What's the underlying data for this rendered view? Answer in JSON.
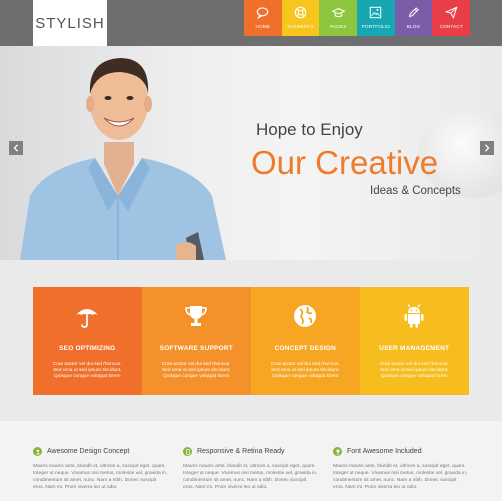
{
  "header": {
    "logo": "STYLISH",
    "nav": [
      {
        "label": "HOME",
        "color": "#f06f2b",
        "icon": "speech-bubble-icon"
      },
      {
        "label": "ELEMENTS",
        "color": "#f7c51e",
        "icon": "lifebuoy-icon"
      },
      {
        "label": "PAGES",
        "color": "#8ec63f",
        "icon": "graduation-cap-icon"
      },
      {
        "label": "PORTFOLIO",
        "color": "#16a7b3",
        "icon": "picture-icon"
      },
      {
        "label": "BLOG",
        "color": "#7a5ca9",
        "icon": "pencil-icon"
      },
      {
        "label": "CONTACT",
        "color": "#e93e47",
        "icon": "paper-plane-icon"
      }
    ]
  },
  "hero": {
    "line1": "Hope to Enjoy",
    "line2": "Our Creative",
    "line3": "Ideas & Concepts"
  },
  "features": [
    {
      "title": "SEO OPTIMIZING",
      "icon": "umbrella-icon",
      "color": "#f06f2b",
      "text": [
        "Cras auctor vel dui sed rhoncus.",
        "Sed urna ut sed ipsum tincidunt.",
        "Quisque congue volutpat lorem"
      ]
    },
    {
      "title": "SOFTWARE SUPPORT",
      "icon": "trophy-icon",
      "color": "#f4912a",
      "text": [
        "Cras auctor vel dui sed rhoncus.",
        "Sed urna ut sed ipsum tincidunt.",
        "Quisque congue volutpat lorem"
      ]
    },
    {
      "title": "CONCEPT DESIGN",
      "icon": "globe-icon",
      "color": "#f6a623",
      "text": [
        "Cras auctor vel dui sed rhoncus.",
        "Sed urna ut sed ipsum tincidunt.",
        "Quisque congue volutpat lorem"
      ]
    },
    {
      "title": "USER MANAGEMENT",
      "icon": "android-icon",
      "color": "#f7bd1e",
      "text": [
        "Cras auctor vel dui sed rhoncus.",
        "Sed urna ut sed ipsum tincidunt.",
        "Quisque congue volutpat lorem"
      ]
    }
  ],
  "columns": [
    {
      "title": "Awesome Design Concept",
      "icon": "person-icon",
      "text": [
        "Mauris mauris ante, blandit et, ultrices a, suscipit eget, quam.",
        "Integer ut neque. Vivamus nisi metus, molestie vel, gravida in,",
        "condimentum sit amet, nunc. Nam a nibh. Donec suscipit",
        "eros. Nam mi. Proin viverra leo ut odio."
      ]
    },
    {
      "title": "Responsive & Retina Ready",
      "icon": "tablet-icon",
      "text": [
        "Mauris mauris ante, blandit et, ultrices a, suscipit eget, quam.",
        "Integer ut neque. Vivamus nisi metus, molestie vel, gravida in,",
        "condimentum sit amet, nunc. Nam a nibh. Donec suscipit",
        "eros. Nam mi. Proin viverra leo ut odio."
      ]
    },
    {
      "title": "Font Awesome Included",
      "icon": "trophy-icon",
      "text": [
        "Mauris mauris ante, blandit et, ultrices a, suscipit eget, quam.",
        "Integer ut neque. Vivamus nisi metus, molestie vel, gravida in,",
        "condimentum sit amet, nunc. Nam a nibh. Donec suscipit",
        "eros. Nam mi. Proin viverra leo ut odio."
      ]
    }
  ]
}
